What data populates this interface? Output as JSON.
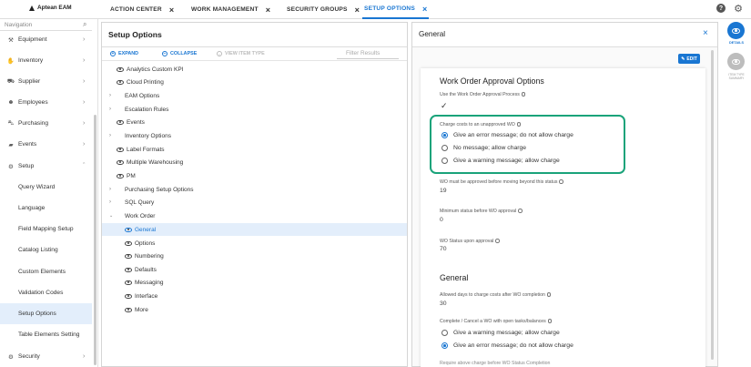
{
  "brand": {
    "name": "Aptean EAM"
  },
  "tabs": [
    {
      "label": "ACTION CENTER"
    },
    {
      "label": "WORK MANAGEMENT"
    },
    {
      "label": "SECURITY GROUPS"
    },
    {
      "label": "SETUP OPTIONS"
    }
  ],
  "search": {
    "placeholder": "Navigation"
  },
  "sidebar": {
    "items": [
      {
        "label": "Equipment",
        "icon": "wrench-icon"
      },
      {
        "label": "Inventory",
        "icon": "hand-box-icon"
      },
      {
        "label": "Supplier",
        "icon": "truck-icon"
      },
      {
        "label": "Employees",
        "icon": "people-icon"
      },
      {
        "label": "Purchasing",
        "icon": "cart-icon"
      },
      {
        "label": "Events",
        "icon": "briefcase-icon"
      },
      {
        "label": "Setup",
        "icon": "gear-icon"
      }
    ],
    "sub_items": [
      {
        "label": "Query Wizard"
      },
      {
        "label": "Language"
      },
      {
        "label": "Field Mapping Setup"
      },
      {
        "label": "Catalog Listing"
      },
      {
        "label": "Custom Elements"
      },
      {
        "label": "Validation Codes"
      },
      {
        "label": "Setup Options"
      },
      {
        "label": "Table Elements Setting"
      }
    ],
    "bottom_item": {
      "label": "Security",
      "icon": "gear-icon"
    }
  },
  "setup_panel": {
    "title": "Setup Options",
    "expand_label": "EXPAND",
    "collapse_label": "COLLAPSE",
    "view_item_type_label": "VIEW ITEM TYPE",
    "filter_placeholder": "Filter Results",
    "tree": [
      {
        "label": "Analytics Custom KPI",
        "kind": "eye"
      },
      {
        "label": "Cloud Printing",
        "kind": "eye"
      },
      {
        "label": "EAM Options",
        "kind": "caret"
      },
      {
        "label": "Escalation Rules",
        "kind": "caret"
      },
      {
        "label": "Events",
        "kind": "eye"
      },
      {
        "label": "Inventory Options",
        "kind": "caret"
      },
      {
        "label": "Label Formats",
        "kind": "eye"
      },
      {
        "label": "Multiple Warehousing",
        "kind": "eye"
      },
      {
        "label": "PM",
        "kind": "eye"
      },
      {
        "label": "Purchasing Setup Options",
        "kind": "caret"
      },
      {
        "label": "SQL Query",
        "kind": "caret"
      },
      {
        "label": "Work Order",
        "kind": "caret-open"
      }
    ],
    "work_order_children": [
      {
        "label": "General",
        "selected": true
      },
      {
        "label": "Options"
      },
      {
        "label": "Numbering"
      },
      {
        "label": "Defaults"
      },
      {
        "label": "Messaging"
      },
      {
        "label": "Interface"
      },
      {
        "label": "More"
      }
    ]
  },
  "general_panel": {
    "title": "General",
    "edit_label": "EDIT",
    "section1_title": "Work Order Approval Options",
    "use_process_label": "Use the Work Order Approval Process",
    "use_process_value": "✓",
    "charge_costs_label": "Charge costs to an unapproved WO",
    "charge_options": [
      {
        "label": "Give an error message; do not allow charge",
        "checked": true
      },
      {
        "label": "No message; allow charge",
        "checked": false
      },
      {
        "label": "Give a warning message; allow charge",
        "checked": false
      }
    ],
    "wo_approved_label": "WO must be approved before moving beyond this status",
    "wo_approved_value": "19",
    "min_status_label": "Minimum status before WO approval",
    "min_status_value": "0",
    "wo_status_label": "WO Status upon approval",
    "wo_status_value": "70",
    "section2_title": "General",
    "allowed_days_label": "Allowed days to charge costs after WO completion",
    "allowed_days_value": "30",
    "complete_label": "Complete / Cancel a WO with open tasks/balances",
    "complete_options": [
      {
        "label": "Give a warning message; allow charge",
        "checked": false
      },
      {
        "label": "Give an error message; do not allow charge",
        "checked": true
      }
    ],
    "cutoff_label": "Require above charge before WO Status Completion"
  },
  "right_rail": {
    "details_label": "DETAILS",
    "item_type_label": "ITEM TYPE SUMMARY"
  },
  "colors": {
    "accent": "#1976d2",
    "highlight_box": "#1aa37a",
    "selected_nav": "#e3eefb"
  }
}
